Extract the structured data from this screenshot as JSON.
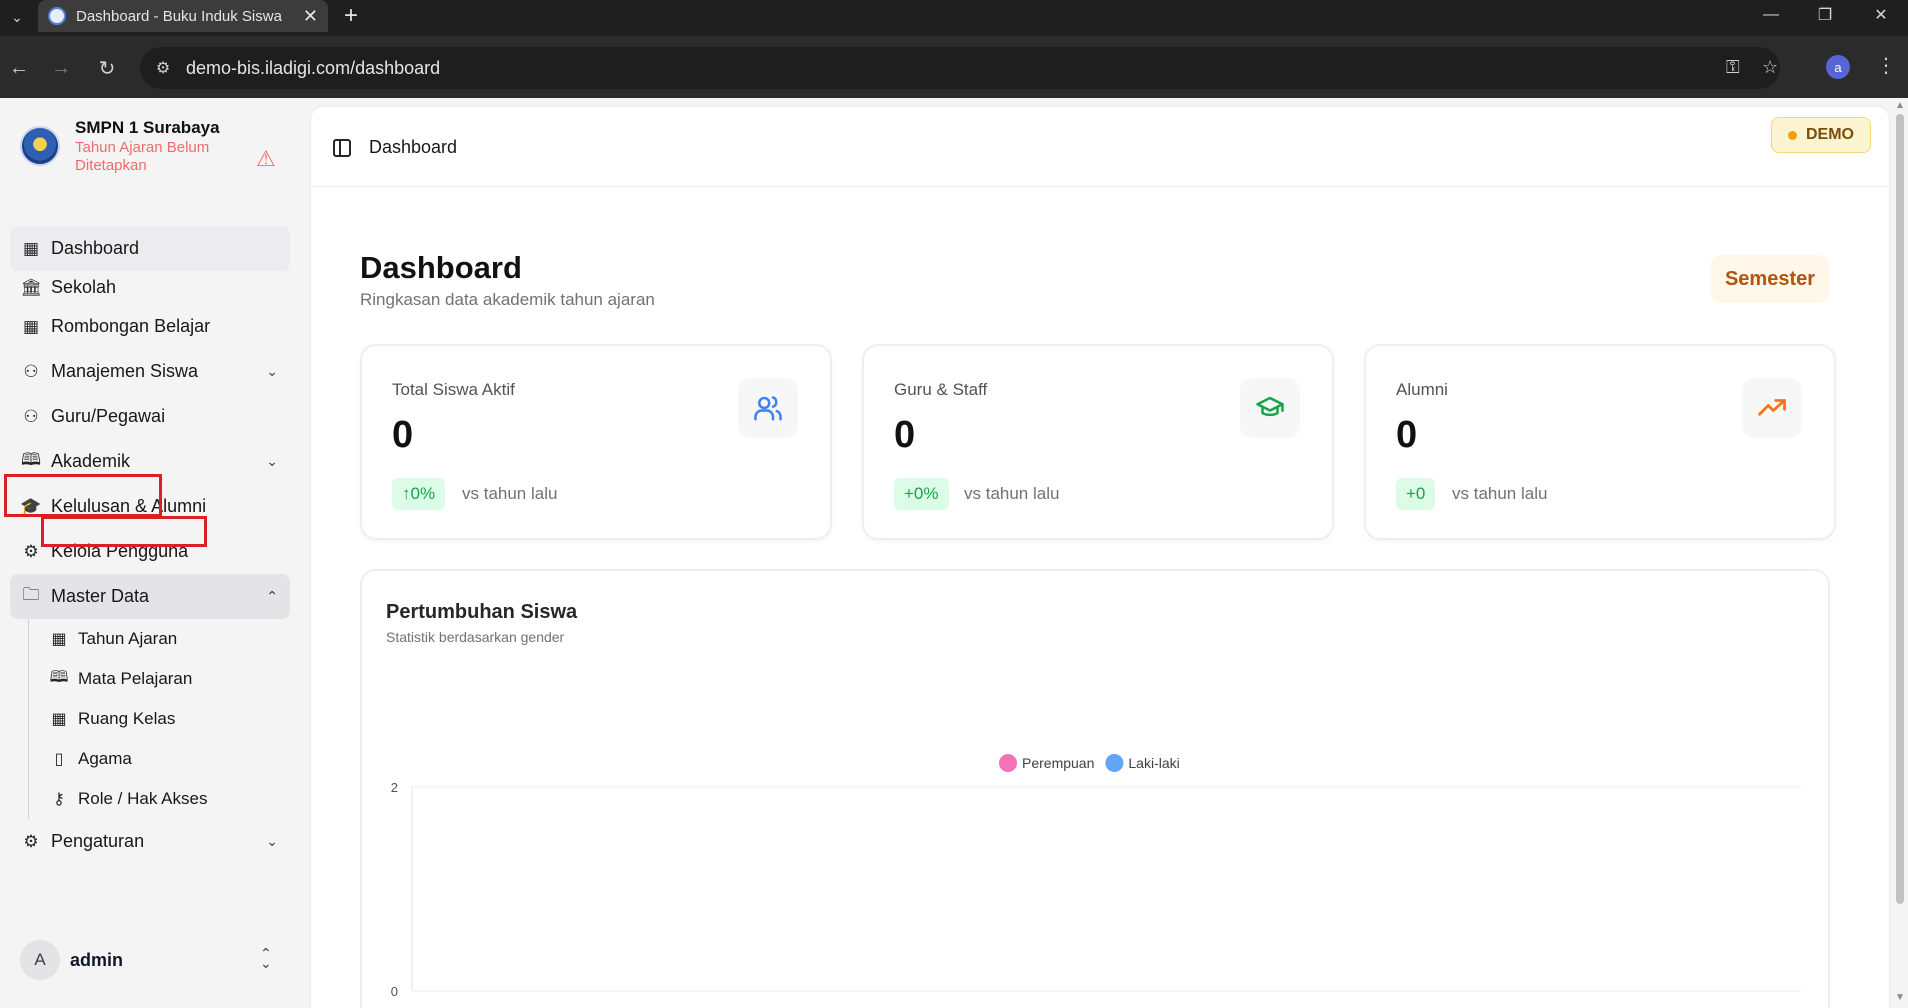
{
  "browser": {
    "tab_title": "Dashboard - Buku Induk Siswa",
    "url": "demo-bis.iladigi.com/dashboard",
    "profile_initial": "a"
  },
  "sidebar": {
    "school_name": "SMPN 1 Surabaya",
    "school_status": "Tahun Ajaran Belum Ditetapkan",
    "items": [
      {
        "label": "Dashboard",
        "icon": "grid-icon"
      },
      {
        "label": "Sekolah",
        "icon": "school-icon"
      },
      {
        "label": "Rombongan Belajar",
        "icon": "grid-icon"
      },
      {
        "label": "Manajemen Siswa",
        "icon": "user-icon"
      },
      {
        "label": "Guru/Pegawai",
        "icon": "users-icon"
      },
      {
        "label": "Akademik",
        "icon": "book-open-icon"
      },
      {
        "label": "Kelulusan & Alumni",
        "icon": "graduation-cap-icon"
      },
      {
        "label": "Kelola Pengguna",
        "icon": "user-cog-icon"
      },
      {
        "label": "Master Data",
        "icon": "folder-icon"
      },
      {
        "label": "Pengaturan",
        "icon": "gear-icon"
      }
    ],
    "master_data_sub": [
      {
        "label": "Tahun Ajaran",
        "icon": "calendar-icon"
      },
      {
        "label": "Mata Pelajaran",
        "icon": "book-open-icon"
      },
      {
        "label": "Ruang Kelas",
        "icon": "grid-icon"
      },
      {
        "label": "Agama",
        "icon": "book-icon"
      },
      {
        "label": "Role / Hak Akses",
        "icon": "key-icon"
      }
    ],
    "user": {
      "initial": "A",
      "name": "admin"
    }
  },
  "header": {
    "breadcrumb": "Dashboard",
    "demo_badge": "DEMO"
  },
  "page": {
    "title": "Dashboard",
    "subtitle": "Ringkasan data akademik tahun ajaran",
    "semester_button": "Semester"
  },
  "stats": [
    {
      "label": "Total Siswa Aktif",
      "value": "0",
      "change": "↑0%",
      "compare": "vs tahun lalu",
      "icon": "users-icon",
      "icon_color": "#3b82f6"
    },
    {
      "label": "Guru & Staff",
      "value": "0",
      "change": "+0%",
      "compare": "vs tahun lalu",
      "icon": "graduation-cap-icon",
      "icon_color": "#16a34a"
    },
    {
      "label": "Alumni",
      "value": "0",
      "change": "+0",
      "compare": "vs tahun lalu",
      "icon": "trending-up-icon",
      "icon_color": "#f97316"
    }
  ],
  "chart_data": {
    "type": "bar",
    "title": "Pertumbuhan Siswa",
    "subtitle": "Statistik berdasarkan gender",
    "categories": [],
    "series": [
      {
        "name": "Perempuan",
        "color": "#f472b6",
        "values": []
      },
      {
        "name": "Laki-laki",
        "color": "#60a5fa",
        "values": []
      }
    ],
    "y_ticks": [
      "2",
      "0"
    ],
    "ylim": [
      0,
      2
    ],
    "legend_position": "top-center"
  }
}
